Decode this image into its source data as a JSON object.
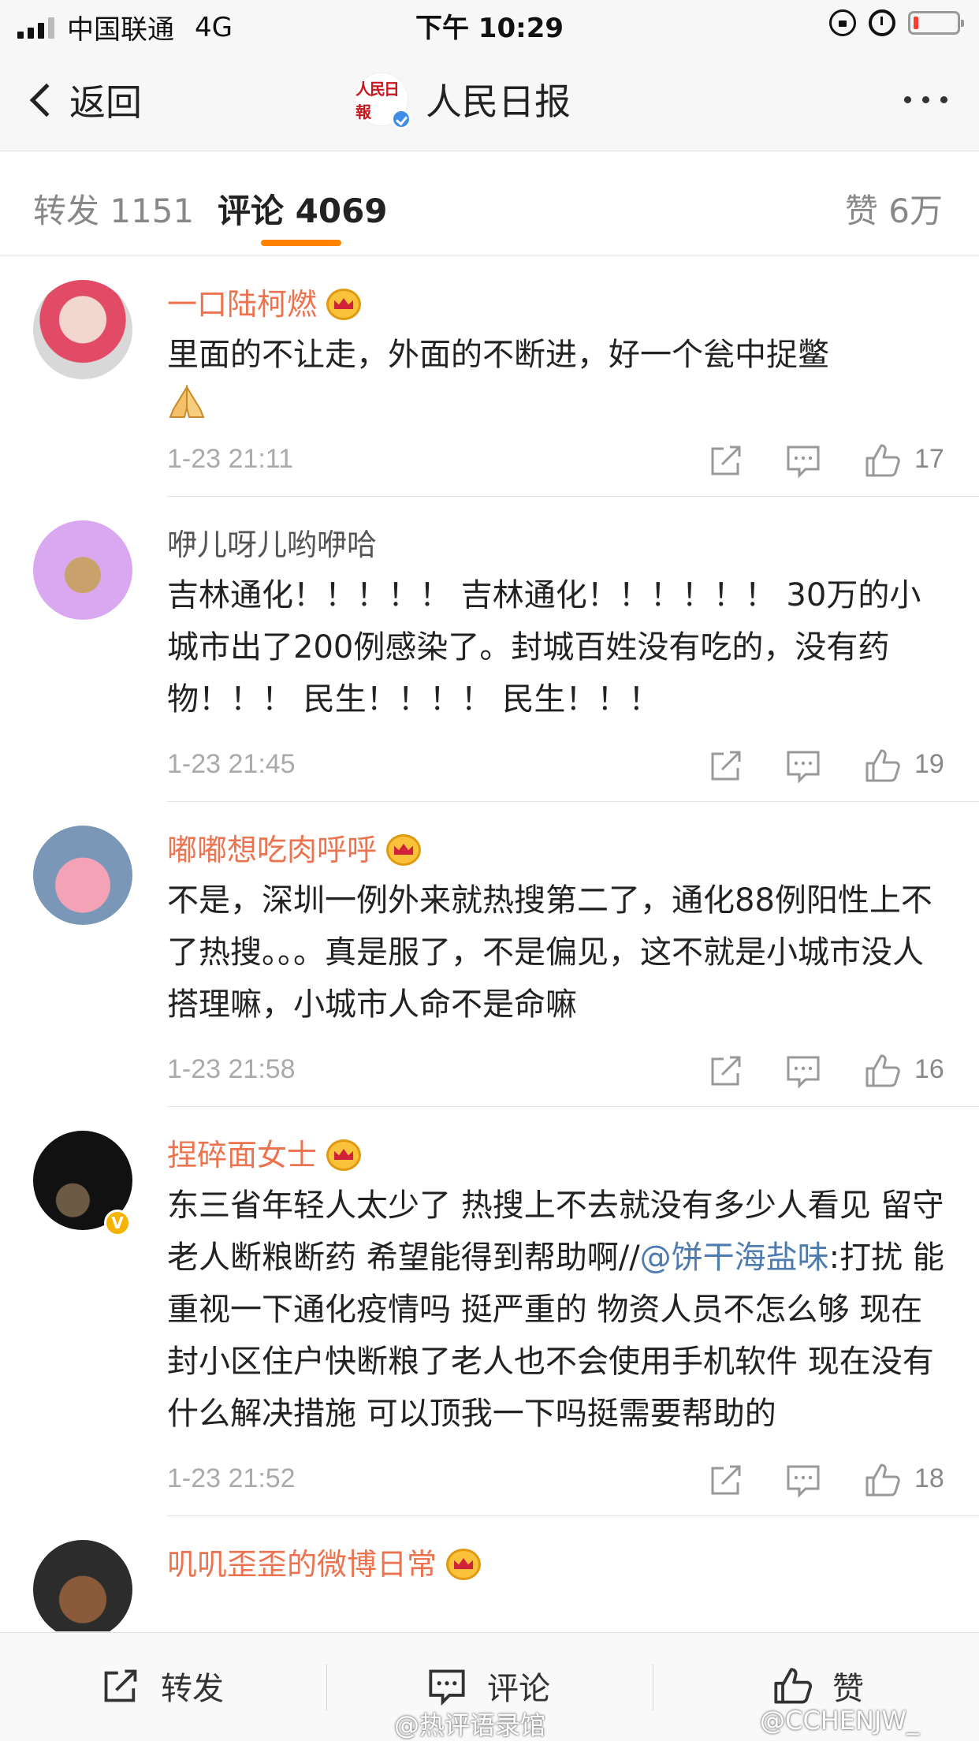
{
  "status_bar": {
    "carrier": "中国联通",
    "network": "4G",
    "time": "下午 10:29"
  },
  "nav": {
    "back_label": "返回",
    "title": "人民日报",
    "logo_text": "人民日报"
  },
  "tabs": {
    "repost": "转发 1151",
    "comment": "评论 4069",
    "like": "赞 6万"
  },
  "comments": [
    {
      "user": "一口陆柯燃",
      "vip": true,
      "text": "里面的不让走，外面的不断进，好一个瓮中捉鳖",
      "emoji": "pray-hands",
      "time": "1-23 21:11",
      "likes": "17"
    },
    {
      "user": "咿儿呀儿哟咿哈",
      "vip": false,
      "text": "吉林通化！！！！！ 吉林通化！！！！！！ 30万的小城市出了200例感染了。封城百姓没有吃的，没有药物！！！ 民生！！！！ 民生！！！",
      "time": "1-23 21:45",
      "likes": "19"
    },
    {
      "user": "嘟嘟想吃肉呼呼",
      "vip": true,
      "text": "不是，深圳一例外来就热搜第二了，通化88例阳性上不了热搜。。。真是服了，不是偏见，这不就是小城市没人搭理嘛，小城市人命不是命嘛",
      "time": "1-23 21:58",
      "likes": "16"
    },
    {
      "user": "捏碎面女士",
      "vip": true,
      "verified_badge": "V",
      "text_before": "东三省年轻人太少了 热搜上不去就没有多少人看见 留守老人断粮断药 希望能得到帮助啊//",
      "mention": "@饼干海盐味",
      "text_after": ":打扰  能重视一下通化疫情吗  挺严重的 物资人员不怎么够 现在封小区住户快断粮了老人也不会使用手机软件 现在没有什么解决措施  可以顶我一下吗挺需要帮助的",
      "time": "1-23 21:52",
      "likes": "18"
    },
    {
      "user": "叽叽歪歪的微博日常",
      "vip": true
    }
  ],
  "toolbar": {
    "repost": "转发",
    "comment": "评论",
    "like": "赞"
  },
  "watermarks": [
    "@热评语录馆",
    "@CCHENJW_"
  ],
  "colors": {
    "accent": "#ff8200",
    "username": "#eb7350",
    "mention": "#4f7cae",
    "verified": "#3e8ee8"
  }
}
